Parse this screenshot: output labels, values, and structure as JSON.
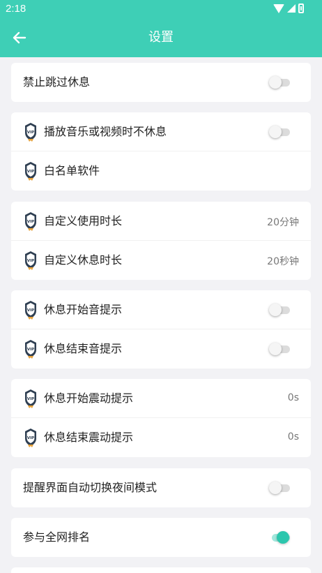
{
  "status_bar": {
    "time": "2:18",
    "icons": [
      "wifi-icon",
      "signal-icon",
      "battery-icon"
    ]
  },
  "header": {
    "title": "设置",
    "back_icon": "arrow-left-icon",
    "color": "#3ecfb6"
  },
  "accent_color": "#2cc6ad",
  "settings": {
    "skip_rest": {
      "label": "禁止跳过休息",
      "enabled": false
    },
    "no_rest_media": {
      "label": "播放音乐或视频时不休息",
      "enabled": false,
      "vip": true
    },
    "whitelist": {
      "label": "白名单软件",
      "vip": true
    },
    "use_duration": {
      "label": "自定义使用时长",
      "value": "20分钟",
      "vip": true
    },
    "rest_duration": {
      "label": "自定义休息时长",
      "value": "20秒钟",
      "vip": true
    },
    "start_sound": {
      "label": "休息开始音提示",
      "enabled": false,
      "vip": true
    },
    "end_sound": {
      "label": "休息结束音提示",
      "enabled": false,
      "vip": true
    },
    "start_vibrate": {
      "label": "休息开始震动提示",
      "value": "0s",
      "vip": true
    },
    "end_vibrate": {
      "label": "休息结束震动提示",
      "value": "0s",
      "vip": true
    },
    "night_mode": {
      "label": "提醒界面自动切换夜间模式",
      "enabled": false
    },
    "ranking": {
      "label": "参与全网排名",
      "enabled": true
    }
  }
}
